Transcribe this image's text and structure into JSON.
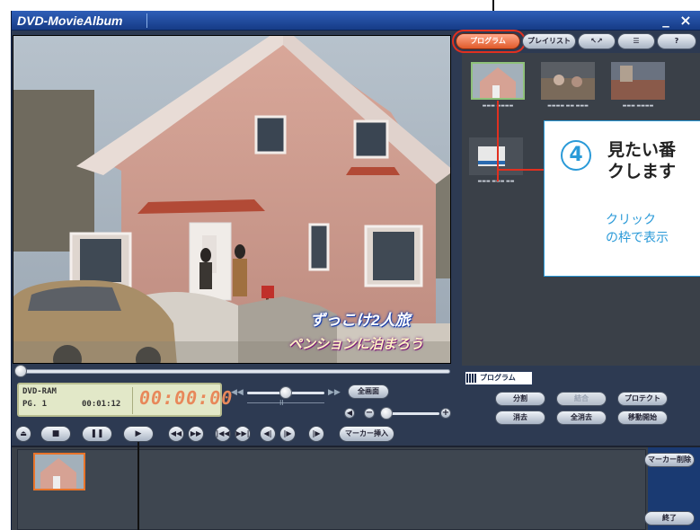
{
  "window": {
    "title": "DVD-MovieAlbum",
    "minimize_glyph": "_",
    "close_glyph": "×"
  },
  "video": {
    "caption_line1": "ずっこけ2人旅",
    "caption_line2": "ペンションに泊まろう"
  },
  "info": {
    "disc": "DVD-RAM",
    "pg": "PG. 1",
    "elapsed": "00:01:12",
    "time": "00:00:00"
  },
  "controls": {
    "fullscreen_label": "全画面",
    "marker_insert_label": "マーカー挿入",
    "speed_slow_icon": "◀◀",
    "speed_fast_icon": "▶▶",
    "speed_mark": "II"
  },
  "tabs": [
    {
      "label": "プログラム"
    },
    {
      "label": "プレイリスト"
    },
    {
      "label": "↖↗"
    },
    {
      "label": "☰"
    },
    {
      "label": "?"
    }
  ],
  "callout": {
    "number": "4",
    "line1": "見たい番",
    "line2": "クします",
    "sub1": "クリック",
    "sub2": "の枠で表示"
  },
  "program": {
    "group_label": "プログラム",
    "buttons": {
      "split": "分割",
      "merge": "結合",
      "protect": "プロテクト",
      "delete": "消去",
      "delete_all": "全消去",
      "move": "移動開始"
    }
  },
  "strip": {
    "marker_delete_label": "マーカー削除",
    "exit_label": "終了"
  },
  "colors": {
    "title_bar": "#1f4fa8",
    "accent_orange": "#e86a3a",
    "callout_blue": "#2a9ad8",
    "highlight_red": "#e03020"
  }
}
